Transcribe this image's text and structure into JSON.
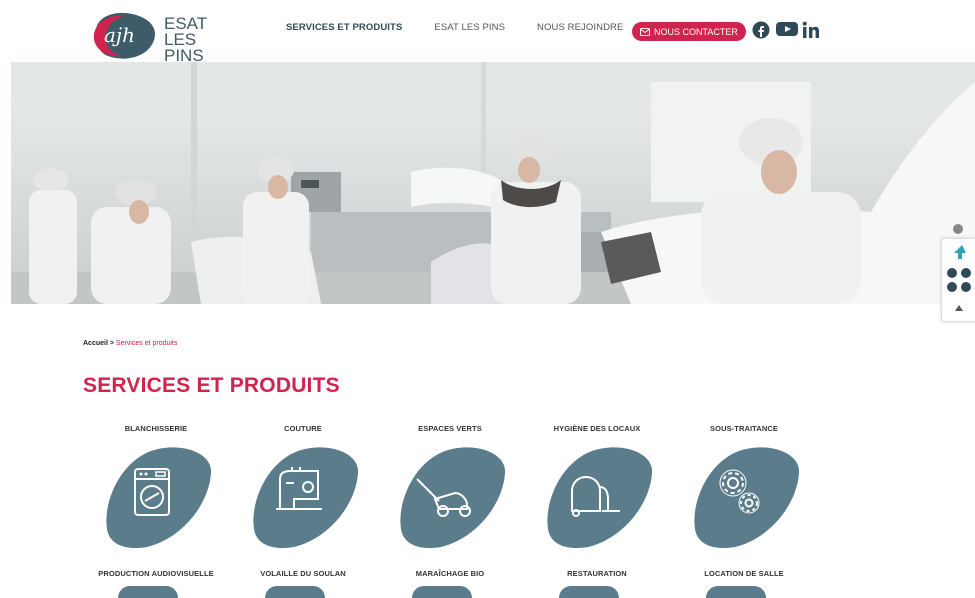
{
  "header": {
    "logo_line1": "ESAT",
    "logo_line2": "LES PINS",
    "logo_mark_text": "ajh",
    "nav": [
      {
        "label": "SERVICES ET PRODUITS",
        "active": true
      },
      {
        "label": "ESAT LES PINS",
        "active": false
      },
      {
        "label": "NOUS REJOINDRE",
        "active": false
      }
    ],
    "contact_label": "NOUS CONTACTER"
  },
  "breadcrumb": {
    "home": "Accueil",
    "separator": ">",
    "current": "Services et produits"
  },
  "page_title": "SERVICES ET PRODUITS",
  "services": [
    {
      "label": "BLANCHISSERIE",
      "icon": "washing-machine-icon"
    },
    {
      "label": "COUTURE",
      "icon": "sewing-machine-icon"
    },
    {
      "label": "ESPACES VERTS",
      "icon": "lawn-mower-icon"
    },
    {
      "label": "HYGIÈNE DES LOCAUX",
      "icon": "vacuum-cleaner-icon"
    },
    {
      "label": "SOUS-TRAITANCE",
      "icon": "gears-icon"
    },
    {
      "label": "PRODUCTION AUDIOVISUELLE",
      "icon": "camera-icon"
    },
    {
      "label": "VOLAILLE DU SOULAN",
      "icon": "poultry-icon"
    },
    {
      "label": "MARAÎCHAGE BIO",
      "icon": "vegetable-icon"
    },
    {
      "label": "RESTAURATION",
      "icon": "restaurant-icon"
    },
    {
      "label": "LOCATION DE SALLE",
      "icon": "room-icon"
    }
  ],
  "colors": {
    "accent": "#d0234e",
    "blob": "#5b7c8a",
    "dark_blue": "#2f4a56"
  }
}
